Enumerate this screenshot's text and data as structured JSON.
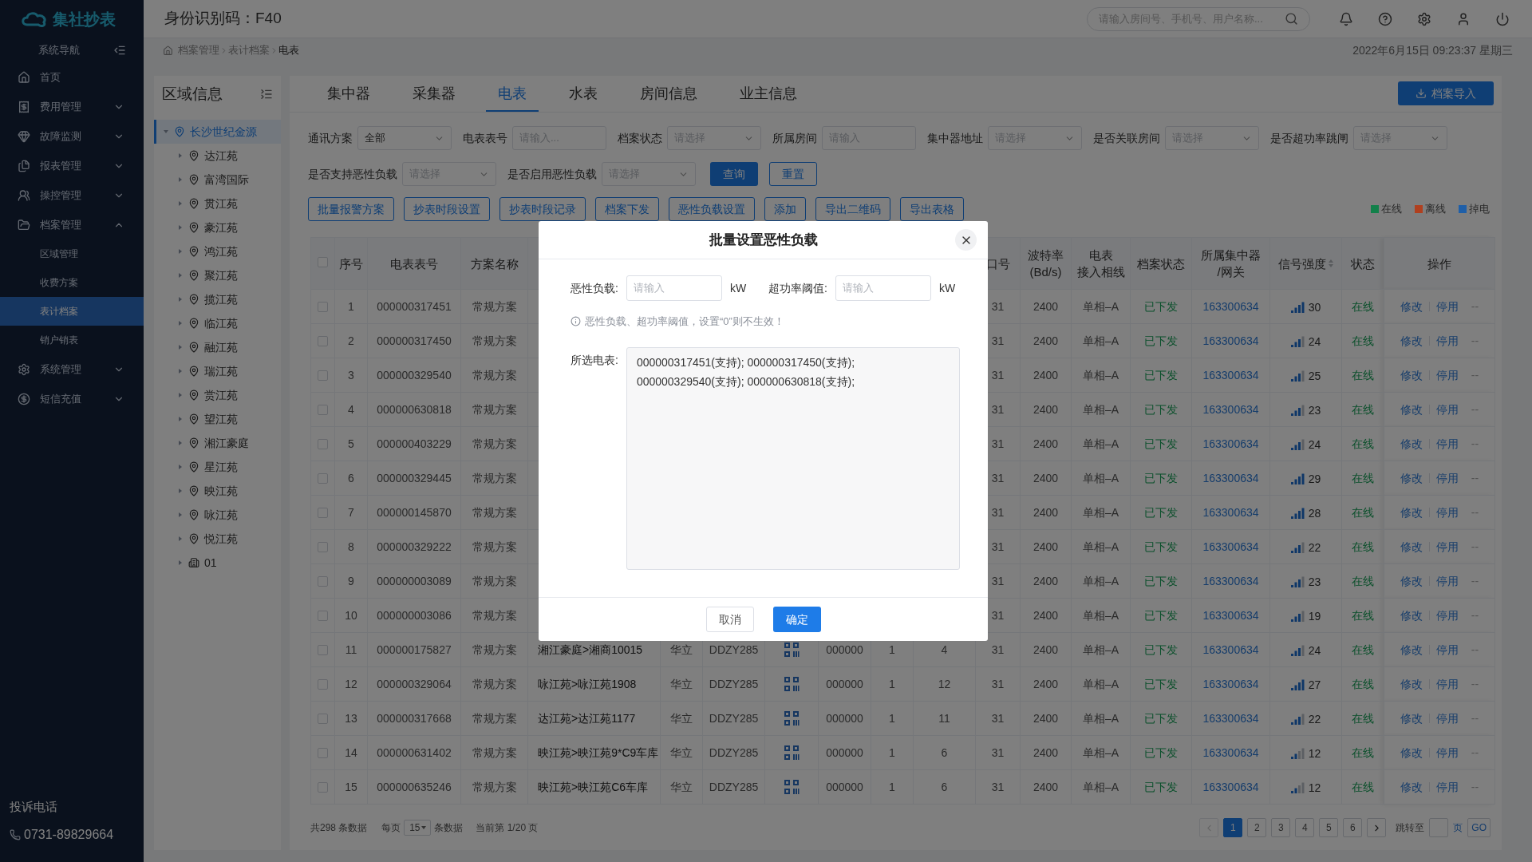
{
  "sidebar": {
    "logo": "集社抄表",
    "nav_title": "系统导航",
    "items": [
      {
        "label": "首页",
        "kind": "link"
      },
      {
        "label": "费用管理",
        "kind": "group",
        "expanded": false
      },
      {
        "label": "故障监测",
        "kind": "group",
        "expanded": false
      },
      {
        "label": "报表管理",
        "kind": "group",
        "expanded": false
      },
      {
        "label": "操控管理",
        "kind": "group",
        "expanded": false
      },
      {
        "label": "档案管理",
        "kind": "group",
        "expanded": true,
        "children": [
          {
            "label": "区域管理",
            "selected": false
          },
          {
            "label": "收费方案",
            "selected": false
          },
          {
            "label": "表计档案",
            "selected": true
          },
          {
            "label": "销户销表",
            "selected": false
          }
        ]
      },
      {
        "label": "系统管理",
        "kind": "group",
        "expanded": false
      },
      {
        "label": "短信充值",
        "kind": "group",
        "expanded": false
      }
    ],
    "hotline_title": "投诉电话",
    "hotline": "0731-89829664"
  },
  "header": {
    "title": "身份识别码：F40",
    "search_placeholder": "请输入房间号、手机号、用户名称..."
  },
  "breadcrumb": [
    "档案管理",
    "表计档案",
    "电表"
  ],
  "datetime": "2022年6月15日 09:23:37 星期三",
  "region_panel": {
    "title": "区域信息",
    "tree": [
      {
        "label": "长沙世纪金源",
        "kind": "community",
        "selected": true,
        "expanded": true,
        "children": [
          {
            "label": "达江苑",
            "kind": "community",
            "selected": false,
            "expanded": false
          },
          {
            "label": "富湾国际",
            "kind": "community",
            "selected": false,
            "expanded": false
          },
          {
            "label": "贯江苑",
            "kind": "community",
            "selected": false,
            "expanded": false
          },
          {
            "label": "豪江苑",
            "kind": "community",
            "selected": false,
            "expanded": false
          },
          {
            "label": "鸿江苑",
            "kind": "community",
            "selected": false,
            "expanded": false
          },
          {
            "label": "聚江苑",
            "kind": "community",
            "selected": false,
            "expanded": false
          },
          {
            "label": "揽江苑",
            "kind": "community",
            "selected": false,
            "expanded": false
          },
          {
            "label": "临江苑",
            "kind": "community",
            "selected": false,
            "expanded": false
          },
          {
            "label": "融江苑",
            "kind": "community",
            "selected": false,
            "expanded": false
          },
          {
            "label": "瑞江苑",
            "kind": "community",
            "selected": false,
            "expanded": false
          },
          {
            "label": "赏江苑",
            "kind": "community",
            "selected": false,
            "expanded": false
          },
          {
            "label": "望江苑",
            "kind": "community",
            "selected": false,
            "expanded": false
          },
          {
            "label": "湘江豪庭",
            "kind": "community",
            "selected": false,
            "expanded": false
          },
          {
            "label": "星江苑",
            "kind": "community",
            "selected": false,
            "expanded": false
          },
          {
            "label": "映江苑",
            "kind": "community",
            "selected": false,
            "expanded": false
          },
          {
            "label": "咏江苑",
            "kind": "community",
            "selected": false,
            "expanded": false
          },
          {
            "label": "悦江苑",
            "kind": "community",
            "selected": false,
            "expanded": false
          },
          {
            "label": "01",
            "kind": "building",
            "selected": false,
            "expanded": false
          }
        ]
      }
    ]
  },
  "tabs": [
    {
      "label": "集中器",
      "selected": false
    },
    {
      "label": "采集器",
      "selected": false
    },
    {
      "label": "电表",
      "selected": true
    },
    {
      "label": "水表",
      "selected": false
    },
    {
      "label": "房间信息",
      "selected": false
    },
    {
      "label": "业主信息",
      "selected": false
    }
  ],
  "import_button": "档案导入",
  "filter_rows": [
    [
      {
        "label": "通讯方案",
        "kind": "select",
        "value": "全部"
      },
      {
        "label": "电表表号",
        "kind": "input",
        "placeholder": "请输入..."
      },
      {
        "label": "档案状态",
        "kind": "select",
        "placeholder": "请选择"
      },
      {
        "label": "所属房间",
        "kind": "input",
        "placeholder": "请输入"
      },
      {
        "label": "集中器地址",
        "kind": "select",
        "placeholder": "请选择"
      },
      {
        "label": "是否关联房间",
        "kind": "select",
        "placeholder": "请选择"
      },
      {
        "label": "是否超功率跳闸",
        "kind": "select",
        "placeholder": "请选择"
      }
    ],
    [
      {
        "label": "是否支持恶性负载",
        "kind": "select",
        "placeholder": "请选择"
      },
      {
        "label": "是否启用恶性负载",
        "kind": "select",
        "placeholder": "请选择"
      }
    ]
  ],
  "search_button": "查询",
  "reset_button": "重置",
  "actions": [
    "批量报警方案",
    "抄表时段设置",
    "抄表时段记录",
    "档案下发",
    "恶性负载设置",
    "添加",
    "导出二维码",
    "导出表格"
  ],
  "legend": [
    {
      "label": "在线",
      "color": "#12804a"
    },
    {
      "label": "离线",
      "color": "#b0401f"
    },
    {
      "label": "掉电",
      "color": "#1f5fa8"
    }
  ],
  "table": {
    "all_checked": false,
    "columns": [
      {
        "kind": "text",
        "label_lines": [
          "序号"
        ]
      },
      {
        "kind": "text",
        "label_lines": [
          "电表表号"
        ]
      },
      {
        "kind": "text",
        "label_lines": [
          "方案名称"
        ]
      },
      {
        "kind": "text"
      },
      {
        "kind": "text"
      },
      {
        "kind": "text"
      },
      {
        "kind": "qr"
      },
      {
        "kind": "text"
      },
      {
        "kind": "text"
      },
      {
        "kind": "text"
      },
      {
        "kind": "text",
        "label_lines": [
          "口号"
        ]
      },
      {
        "kind": "text",
        "label_lines": [
          "波特率",
          "(Bd/s)"
        ]
      },
      {
        "kind": "text",
        "label_lines": [
          "电表",
          "接入相线"
        ]
      },
      {
        "kind": "status",
        "label_lines": [
          "档案状态"
        ]
      },
      {
        "kind": "link",
        "label_lines": [
          "所属集中器",
          "/网关"
        ]
      },
      {
        "kind": "signal",
        "label_lines": [
          "信号强度"
        ],
        "sortable": true
      },
      {
        "kind": "status",
        "label_lines": [
          "状态"
        ]
      },
      {
        "kind": "actions",
        "label_lines": [
          "操作"
        ]
      }
    ],
    "rows": [
      {
        "checked": false,
        "no": "1",
        "meter": "000000317451",
        "scheme": "常规方案",
        "port": "31",
        "baud": "2400",
        "phase": "单相–A",
        "archive": "已下发",
        "gateway": "163300634",
        "signal": "30",
        "status": "在线",
        "actions": [
          "修改",
          "停用",
          "--"
        ]
      },
      {
        "checked": false,
        "no": "2",
        "meter": "000000317450",
        "scheme": "常规方案",
        "port": "31",
        "baud": "2400",
        "phase": "单相–A",
        "archive": "已下发",
        "gateway": "163300634",
        "signal": "24",
        "status": "在线",
        "actions": [
          "修改",
          "停用",
          "--"
        ]
      },
      {
        "checked": false,
        "no": "3",
        "meter": "000000329540",
        "scheme": "常规方案",
        "port": "31",
        "baud": "2400",
        "phase": "单相–A",
        "archive": "已下发",
        "gateway": "163300634",
        "signal": "25",
        "status": "在线",
        "actions": [
          "修改",
          "停用",
          "--"
        ]
      },
      {
        "checked": false,
        "no": "4",
        "meter": "000000630818",
        "scheme": "常规方案",
        "port": "31",
        "baud": "2400",
        "phase": "单相–A",
        "archive": "已下发",
        "gateway": "163300634",
        "signal": "23",
        "status": "在线",
        "actions": [
          "修改",
          "停用",
          "--"
        ]
      },
      {
        "checked": false,
        "no": "5",
        "meter": "000000403229",
        "scheme": "常规方案",
        "port": "31",
        "baud": "2400",
        "phase": "单相–A",
        "archive": "已下发",
        "gateway": "163300634",
        "signal": "24",
        "status": "在线",
        "actions": [
          "修改",
          "停用",
          "--"
        ]
      },
      {
        "checked": false,
        "no": "6",
        "meter": "000000329445",
        "scheme": "常规方案",
        "port": "31",
        "baud": "2400",
        "phase": "单相–A",
        "archive": "已下发",
        "gateway": "163300634",
        "signal": "29",
        "status": "在线",
        "actions": [
          "修改",
          "停用",
          "--"
        ]
      },
      {
        "checked": false,
        "no": "7",
        "meter": "000000145870",
        "scheme": "常规方案",
        "port": "31",
        "baud": "2400",
        "phase": "单相–A",
        "archive": "已下发",
        "gateway": "163300634",
        "signal": "28",
        "status": "在线",
        "actions": [
          "修改",
          "停用",
          "--"
        ]
      },
      {
        "checked": false,
        "no": "8",
        "meter": "000000329222",
        "scheme": "常规方案",
        "port": "31",
        "baud": "2400",
        "phase": "单相–A",
        "archive": "已下发",
        "gateway": "163300634",
        "signal": "22",
        "status": "在线",
        "actions": [
          "修改",
          "停用",
          "--"
        ]
      },
      {
        "checked": false,
        "no": "9",
        "meter": "000000003089",
        "scheme": "常规方案",
        "port": "31",
        "baud": "2400",
        "phase": "单相–A",
        "archive": "已下发",
        "gateway": "163300634",
        "signal": "23",
        "status": "在线",
        "actions": [
          "修改",
          "停用",
          "--"
        ]
      },
      {
        "checked": false,
        "no": "10",
        "meter": "000000003086",
        "scheme": "常规方案",
        "port": "31",
        "baud": "2400",
        "phase": "单相–A",
        "archive": "已下发",
        "gateway": "163300634",
        "signal": "19",
        "status": "在线",
        "actions": [
          "修改",
          "停用",
          "--"
        ]
      },
      {
        "checked": false,
        "no": "11",
        "meter": "000000175827",
        "scheme": "常规方案",
        "room": "湘江豪庭>湘商10015",
        "maker": "华立",
        "model": "DDZY285",
        "qr": true,
        "address": "000000",
        "column_10": "1",
        "column_11": "4",
        "port": "31",
        "baud": "2400",
        "phase": "单相–A",
        "archive": "已下发",
        "gateway": "163300634",
        "signal": "24",
        "status": "在线",
        "actions": [
          "修改",
          "停用",
          "--"
        ]
      },
      {
        "checked": false,
        "no": "12",
        "meter": "000000329064",
        "scheme": "常规方案",
        "room": "咏江苑>咏江苑1908",
        "maker": "华立",
        "model": "DDZY285",
        "qr": true,
        "address": "000000",
        "column_10": "1",
        "column_11": "12",
        "port": "31",
        "baud": "2400",
        "phase": "单相–A",
        "archive": "已下发",
        "gateway": "163300634",
        "signal": "27",
        "status": "在线",
        "actions": [
          "修改",
          "停用",
          "--"
        ]
      },
      {
        "checked": false,
        "no": "13",
        "meter": "000000317668",
        "scheme": "常规方案",
        "room": "达江苑>达江苑1177",
        "maker": "华立",
        "model": "DDZY285",
        "qr": true,
        "address": "000000",
        "column_10": "1",
        "column_11": "11",
        "port": "31",
        "baud": "2400",
        "phase": "单相–A",
        "archive": "已下发",
        "gateway": "163300634",
        "signal": "22",
        "status": "在线",
        "actions": [
          "修改",
          "停用",
          "--"
        ]
      },
      {
        "checked": false,
        "no": "14",
        "meter": "000000631402",
        "scheme": "常规方案",
        "room": "映江苑>映江苑9*C9车库",
        "maker": "华立",
        "model": "DDZY285",
        "qr": true,
        "address": "000000",
        "column_10": "1",
        "column_11": "6",
        "port": "31",
        "baud": "2400",
        "phase": "单相–A",
        "archive": "已下发",
        "gateway": "163300634",
        "signal": "12",
        "status": "在线",
        "actions": [
          "修改",
          "停用",
          "--"
        ]
      },
      {
        "checked": false,
        "no": "15",
        "meter": "000000635246",
        "scheme": "常规方案",
        "room": "映江苑>映江苑C6车库",
        "maker": "华立",
        "model": "DDZY285",
        "qr": true,
        "address": "000000",
        "column_10": "1",
        "column_11": "6",
        "port": "31",
        "baud": "2400",
        "phase": "单相–A",
        "archive": "已下发",
        "gateway": "163300634",
        "signal": "12",
        "status": "在线",
        "actions": [
          "修改",
          "停用",
          "--"
        ]
      }
    ]
  },
  "pagination": {
    "total": "共298 条数据",
    "per_page_prefix": "每页",
    "per_page": "15",
    "per_page_suffix": "条数据",
    "current": "当前第 1/20 页",
    "prev_disabled": true,
    "next_disabled": false,
    "pages": [
      {
        "label": "1",
        "selected": true
      },
      {
        "label": "2",
        "selected": false
      },
      {
        "label": "3",
        "selected": false
      },
      {
        "label": "4",
        "selected": false
      },
      {
        "label": "5",
        "selected": false
      },
      {
        "label": "6",
        "selected": false
      }
    ],
    "jump_label": "跳转至",
    "page_unit": "页",
    "go": "GO"
  },
  "modal": {
    "title": "批量设置恶性负载",
    "fields": [
      {
        "label": "恶性负载:",
        "placeholder": "请输入",
        "unit": "kW"
      },
      {
        "label": "超功率阈值:",
        "placeholder": "请输入",
        "unit": "kW"
      }
    ],
    "hint": "恶性负载、超功率阈值，设置“0”则不生效！",
    "selected_label": "所选电表:",
    "selected_value": "000000317451(支持); 000000317450(支持); 000000329540(支持); 000000630818(支持);",
    "cancel": "取消",
    "confirm": "确定"
  }
}
